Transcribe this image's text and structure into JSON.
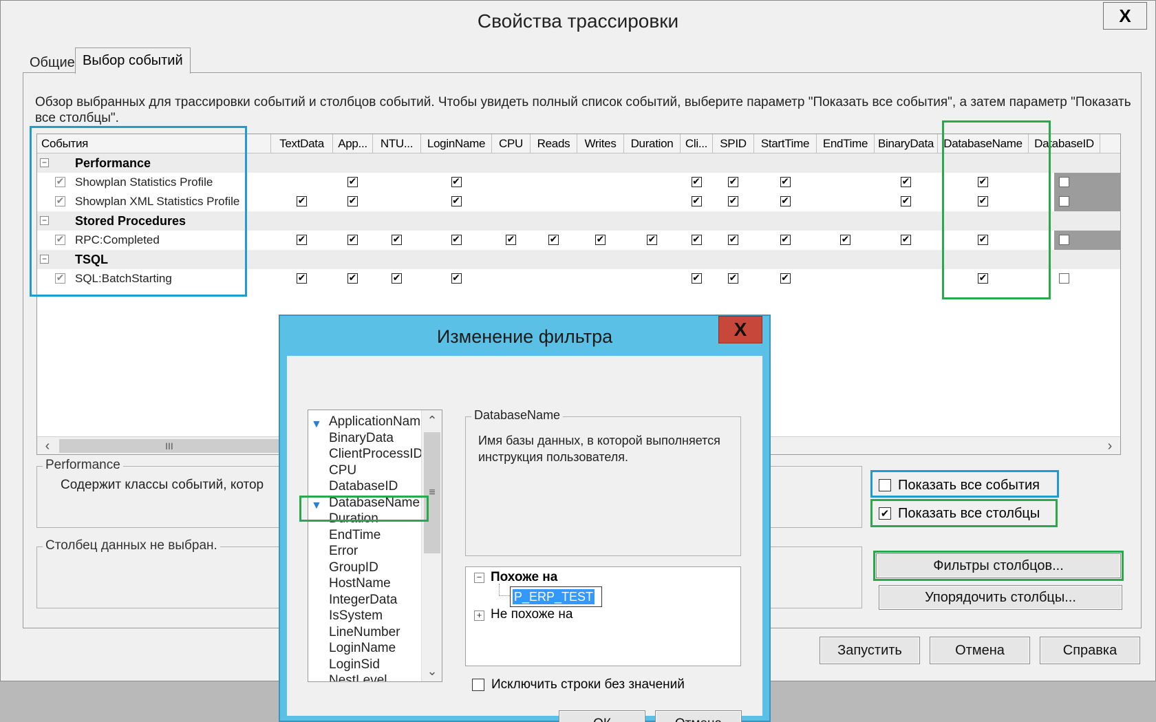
{
  "main": {
    "title": "Свойства трассировки",
    "close": "X",
    "tabs": [
      "Общие",
      "Выбор событий"
    ],
    "description": "Обзор выбранных для трассировки событий и столбцов событий. Чтобы увидеть полный список событий, выберите параметр \"Показать все события\", а затем параметр \"Показать все столбцы\"."
  },
  "grid": {
    "columns": [
      "События",
      "TextData",
      "App...",
      "NTU...",
      "LoginName",
      "CPU",
      "Reads",
      "Writes",
      "Duration",
      "Cli...",
      "SPID",
      "StartTime",
      "EndTime",
      "BinaryData",
      "DatabaseName",
      "DatabaseID"
    ],
    "rows": [
      {
        "type": "category",
        "label": "Performance",
        "expander": "−"
      },
      {
        "type": "event",
        "label": "Showplan Statistics Profile",
        "checks": [
          0,
          1,
          0,
          1,
          0,
          0,
          0,
          0,
          1,
          1,
          1,
          0,
          1,
          1,
          0
        ]
      },
      {
        "type": "event",
        "label": "Showplan XML Statistics Profile",
        "checks": [
          1,
          1,
          0,
          1,
          0,
          0,
          0,
          0,
          1,
          1,
          1,
          0,
          1,
          1,
          0
        ]
      },
      {
        "type": "category",
        "label": "Stored Procedures",
        "expander": "−"
      },
      {
        "type": "event",
        "label": "RPC:Completed",
        "checks": [
          1,
          1,
          1,
          1,
          1,
          1,
          1,
          1,
          1,
          1,
          1,
          1,
          1,
          1,
          0
        ]
      },
      {
        "type": "category",
        "label": "TSQL",
        "expander": "−"
      },
      {
        "type": "event",
        "label": "SQL:BatchStarting",
        "checks": [
          1,
          1,
          1,
          1,
          0,
          0,
          0,
          0,
          1,
          1,
          1,
          0,
          0,
          1,
          0
        ]
      }
    ],
    "scroll_thumb": "III"
  },
  "performance_box": {
    "legend": "Performance",
    "text": "Содержит классы событий, котор"
  },
  "column_box": {
    "legend": "Столбец данных не выбран."
  },
  "options": {
    "show_all_events": {
      "label": "Показать все события",
      "checked": false
    },
    "show_all_columns": {
      "label": "Показать все столбцы",
      "checked": true
    }
  },
  "buttons": {
    "column_filters": "Фильтры столбцов...",
    "organize_columns": "Упорядочить столбцы...",
    "run": "Запустить",
    "cancel": "Отмена",
    "help": "Справка"
  },
  "filter_dialog": {
    "title": "Изменение фильтра",
    "close": "X",
    "fields": [
      "ApplicationName",
      "BinaryData",
      "ClientProcessID",
      "CPU",
      "DatabaseID",
      "DatabaseName",
      "Duration",
      "EndTime",
      "Error",
      "GroupID",
      "HostName",
      "IntegerData",
      "IsSystem",
      "LineNumber",
      "LoginName",
      "LoginSid",
      "NestLevel"
    ],
    "filtered_fields": [
      "ApplicationName",
      "DatabaseName"
    ],
    "selected_field": "DatabaseName",
    "info_legend": "DatabaseName",
    "info_text": "Имя базы данных, в которой выполняется инструкция пользователя.",
    "tree": {
      "like": "Похоже на",
      "like_value": "P_ERP_TEST",
      "not_like": "Не похоже на"
    },
    "exclude_label": "Исключить строки без значений",
    "ok": "ОК",
    "cancel": "Отмена"
  },
  "colors": {
    "highlight_blue": "#1e9bd0",
    "highlight_green": "#2aa84a",
    "dialog_frame": "#5bc0e6",
    "close_red": "#c8473b"
  }
}
